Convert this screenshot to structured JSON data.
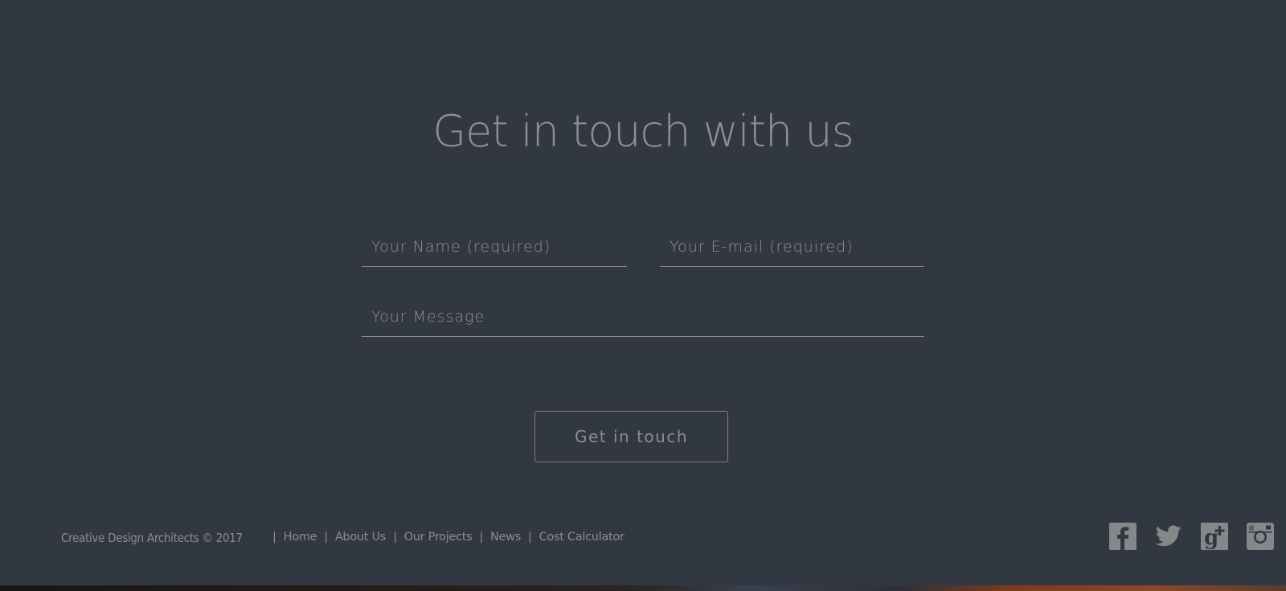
{
  "contact": {
    "title": "Get in touch with us",
    "name_placeholder": "Your Name (required)",
    "email_placeholder": "Your E-mail (required)",
    "message_placeholder": "Your Message",
    "submit_label": "Get in touch"
  },
  "footer": {
    "copyright": "Creative Design Architects © 2017",
    "separator": "|",
    "nav": [
      {
        "label": "Home"
      },
      {
        "label": "About Us"
      },
      {
        "label": "Our Projects"
      },
      {
        "label": "News"
      },
      {
        "label": "Cost Calculator"
      }
    ],
    "social": [
      {
        "name": "facebook-icon"
      },
      {
        "name": "twitter-icon"
      },
      {
        "name": "google-plus-icon"
      },
      {
        "name": "instagram-icon"
      }
    ]
  },
  "colors": {
    "background": "#323841",
    "text": "#8b8d90",
    "icon": "#85878a"
  }
}
